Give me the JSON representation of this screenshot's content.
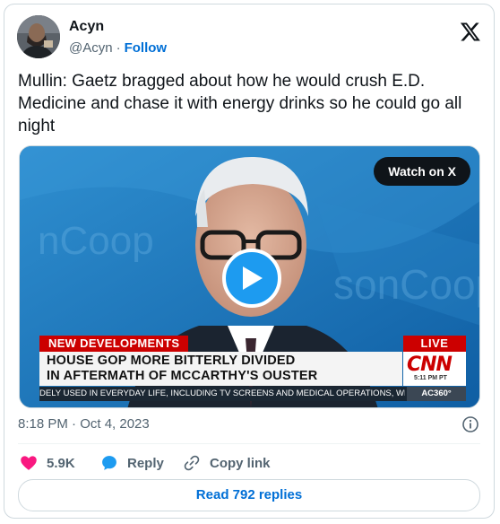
{
  "author": {
    "name": "Acyn",
    "handle": "@Acyn",
    "separator": "·",
    "follow_label": "Follow"
  },
  "tweet": {
    "text": "Mullin: Gaetz bragged about how he would crush E.D. Medicine and chase it with energy drinks so he could go all night"
  },
  "media": {
    "watch_label": "Watch on X",
    "chyron": {
      "label": "NEW DEVELOPMENTS",
      "live": "LIVE",
      "headline_line1": "HOUSE GOP MORE BITTERLY DIVIDED",
      "headline_line2": "IN AFTERMATH OF MCCARTHY'S OUSTER",
      "network": "CNN",
      "time": "5:11 PM PT",
      "ticker": "DELY USED IN EVERYDAY LIFE, INCLUDING TV SCREENS AND MEDICAL OPERATIONS, WHE",
      "show": "AC360°"
    }
  },
  "meta": {
    "timestamp": "8:18 PM · Oct 4, 2023"
  },
  "actions": {
    "likes": "5.9K",
    "reply": "Reply",
    "copy_link": "Copy link"
  },
  "read_replies": "Read 792 replies",
  "colors": {
    "accent": "#006fd6",
    "like": "#f91880",
    "reply_icon": "#1d9bf0",
    "cnn_red": "#cc0000"
  },
  "icons": {
    "brand": "x-logo-icon",
    "play": "play-icon",
    "info": "info-icon",
    "like": "heart-icon",
    "reply": "speech-bubble-icon",
    "copy": "link-icon"
  }
}
